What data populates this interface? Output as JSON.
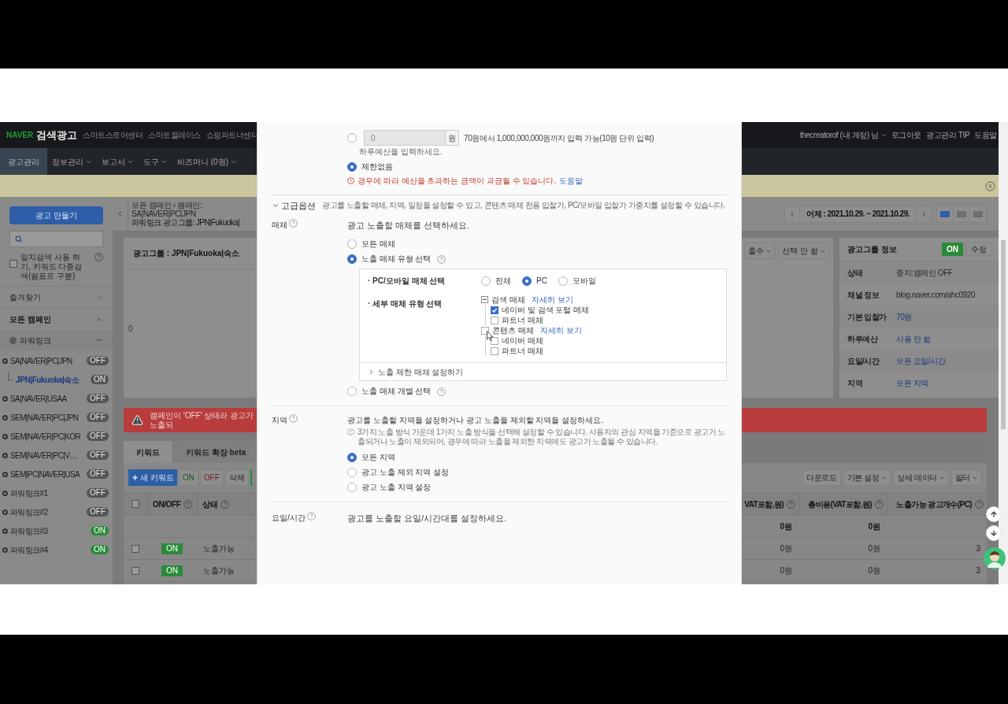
{
  "top_nav": {
    "logo_brand": "NAVER",
    "logo_title": "검색광고",
    "links": [
      "스마트스토어센터",
      "스마트플레이스",
      "쇼핑파트너센터"
    ],
    "account": "thecreatorof (내 계정) 님",
    "right_links": [
      "로그아웃",
      "광고관리 TIP",
      "도움말"
    ]
  },
  "main_menu": [
    {
      "label": "광고관리",
      "selected": true,
      "dropdown": false
    },
    {
      "label": "정보관리",
      "selected": false,
      "dropdown": true
    },
    {
      "label": "보고서",
      "selected": false,
      "dropdown": true
    },
    {
      "label": "도구",
      "selected": false,
      "dropdown": true
    },
    {
      "label": "비즈머니 (0원)",
      "selected": false,
      "dropdown": true
    }
  ],
  "sidebar": {
    "create_button": "광고 만들기",
    "exact_search": {
      "label": "일치검색 사용 하기, 키워드 다중검색(쉼표로 구분)",
      "checked": false
    },
    "favorites": "즐겨찾기",
    "all_campaigns": "모든 캠페인",
    "campaign_group": "파워링크",
    "campaigns": [
      {
        "name": "SA|NAVER|PC|JPN",
        "badge": "OFF",
        "active": false,
        "selected": false,
        "children": [
          {
            "name": "JPN|Fukuoka|숙소",
            "badge": "ON",
            "active": false,
            "selected": true
          }
        ]
      },
      {
        "name": "SA|NAVER|USAA",
        "badge": "OFF",
        "active": false,
        "selected": false
      },
      {
        "name": "SEM|NAVER|PC|JPN",
        "badge": "OFF",
        "active": false,
        "selected": false
      },
      {
        "name": "SEM|NAVER|PC|KOR",
        "badge": "OFF",
        "active": false,
        "selected": false
      },
      {
        "name": "SEM|NAVER|PC|V…",
        "badge": "OFF",
        "active": false,
        "selected": false
      },
      {
        "name": "SEM|PC|NAVER|USA",
        "badge": "OFF",
        "active": false,
        "selected": false
      },
      {
        "name": "파워링크#1",
        "badge": "OFF",
        "active": false,
        "selected": false
      },
      {
        "name": "파워링크#2",
        "badge": "OFF",
        "active": false,
        "selected": false
      },
      {
        "name": "파워링크#3",
        "badge": "ON",
        "active": true,
        "selected": false
      },
      {
        "name": "파워링크#4",
        "badge": "ON",
        "active": true,
        "selected": false
      }
    ]
  },
  "content": {
    "breadcrumb": "모든 캠페인 › 캠페인: SA|NAVER|PC|JPN",
    "title": "파워링크 광고그룹: JPN|Fukuoka|",
    "card_title": "광고그룹 : JPN|Fukuoka|숙소",
    "chart_zero": "0",
    "alert": "캠페인이 'OFF' 상태라 광고가 노출되",
    "date_range": "어제 : 2021.10.29. ~ 2021.10.29.",
    "view_modes": [
      {
        "selected": true
      },
      {
        "selected": false
      },
      {
        "selected": false
      }
    ],
    "chart_selects": [
      "출수",
      "선택 안 함"
    ],
    "info": {
      "title": "광고그룹 정보",
      "toggle": {
        "label": "ON",
        "on": true
      },
      "edit": "수정",
      "rows": [
        {
          "label": "상태",
          "value": "중지:캠페인 OFF",
          "kind": "text"
        },
        {
          "label": "채널 정보",
          "value": "blog.naver.com/ahc0920",
          "kind": "text"
        },
        {
          "label": "기본 입찰가",
          "value": "70원",
          "kind": "link"
        },
        {
          "label": "하루예산",
          "value": "사용 안 함",
          "kind": "link"
        },
        {
          "label": "요일/시간",
          "value": "모든 요일/시간",
          "kind": "link"
        },
        {
          "label": "지역",
          "value": "모든 지역",
          "kind": "link"
        }
      ]
    },
    "tabs": [
      {
        "label": "키워드",
        "selected": true
      },
      {
        "label": "키워드 확장 beta",
        "selected": false
      }
    ],
    "toolbar": {
      "new_keyword": "새 키워드",
      "on": "ON",
      "off": "OFF",
      "delete": "삭제",
      "right": [
        {
          "label": "다운로드",
          "dropdown": false
        },
        {
          "label": "기본 설정",
          "dropdown": true
        },
        {
          "label": "상세 데이터",
          "dropdown": true
        },
        {
          "label": "필터",
          "dropdown": true
        }
      ]
    },
    "table": {
      "header_checked": false,
      "left_columns": [
        "ON/OFF",
        "상태"
      ],
      "right_columns": [
        "VAT포함,원)",
        "총비용(VAT포함,원)",
        "노출가능 광고개수(PC)"
      ],
      "summary": [
        "0원",
        "0원"
      ],
      "rows": [
        {
          "checked": false,
          "on": true,
          "toggle": "ON",
          "status": "노출가능",
          "cells": [
            "0원",
            "0원",
            "3"
          ]
        },
        {
          "checked": false,
          "on": true,
          "toggle": "ON",
          "status": "노출가능",
          "cells": [
            "0원",
            "0원",
            "3"
          ]
        }
      ]
    }
  },
  "modal": {
    "budget": {
      "selected": false,
      "value": "0",
      "unit": "원",
      "range_note": "70원에서 1,000,000,000원까지 입력 가능(10원 단위 입력)",
      "hint": "하루예산을 입력하세요."
    },
    "unlimited": {
      "label": "제한없음",
      "selected": true
    },
    "warning": "경우에 따라 예산을 초과하는 금액이 과금될 수 있습니다.",
    "help_link": "도움말",
    "advanced": {
      "title": "고급옵션",
      "expanded": true,
      "description": "광고를 노출할 매체, 지역, 일정을 설정할 수 있고, 콘텐츠 매체 전용 입찰가, PC/모바일 입찰가 가중치를 설정할 수 있습니다."
    },
    "media": {
      "label": "매체",
      "intro": "광고 노출할 매체를 선택하세요.",
      "options": [
        {
          "label": "모든 매체",
          "selected": false,
          "help": false
        },
        {
          "label": "노출 매체 유형 선택",
          "selected": true,
          "help": true
        }
      ],
      "device_label": "· PC/모바일 매체 선택",
      "devices": [
        {
          "label": "전체",
          "selected": false
        },
        {
          "label": "PC",
          "selected": true
        },
        {
          "label": "모바일",
          "selected": false
        }
      ],
      "detail_label": "· 세부 매체 유형 선택",
      "groups": [
        {
          "label": "검색 매체",
          "kind": "expander",
          "expanded": true,
          "link": "자세히 보기",
          "children": [
            {
              "label": "네이버 및 검색 포털 매체",
              "checked": true
            },
            {
              "label": "파트너 매체",
              "checked": false
            }
          ]
        },
        {
          "label": "콘텐츠 매체",
          "kind": "checkbox",
          "checked": false,
          "link": "자세히 보기",
          "children": [
            {
              "label": "네이버 매체",
              "checked": false
            },
            {
              "label": "파트너 매체",
              "checked": false
            }
          ]
        }
      ],
      "restrict": "노출 제한 매체 설정하기",
      "individual": {
        "label": "노출 매체 개별 선택",
        "selected": false
      }
    },
    "region": {
      "label": "지역",
      "intro": "광고를 노출할 지역을 설정하거나 광고 노출을 제외할 지역을 설정하세요.",
      "info": "3가지 노출 방식 가운데 1가지 노출 방식을 선택해 설정할 수 있습니다. 사용자의 관심 지역을 기준으로 광고가 노출되거나 노출이 제외되어, 경우에 따라 노출을 제외한 지역에도 광고가 노출될 수 있습니다.",
      "options": [
        {
          "label": "모든 지역",
          "selected": true
        },
        {
          "label": "광고 노출 제외 지역 설정",
          "selected": false
        },
        {
          "label": "광고 노출 지역 설정",
          "selected": false
        }
      ]
    },
    "schedule": {
      "label": "요일/시간",
      "intro": "광고를 노출할 요일/시간대를 설정하세요."
    }
  }
}
